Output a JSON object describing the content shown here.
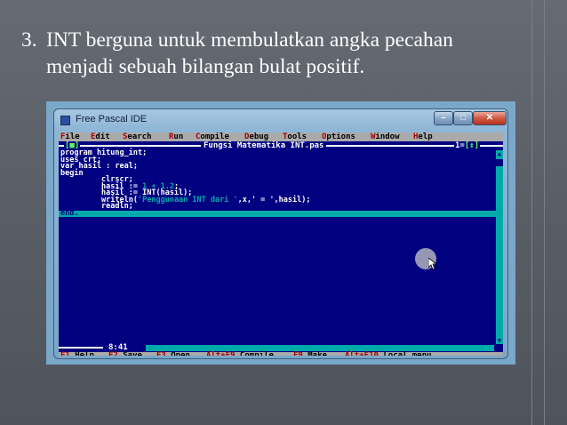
{
  "slide": {
    "number": "3.",
    "line1": "INT berguna untuk membulatkan angka pecahan",
    "line2": "menjadi sebuah bilangan bulat positif."
  },
  "window": {
    "title": "Free Pascal IDE",
    "minimize": "–",
    "maximize": "□",
    "close": "✕"
  },
  "menu": [
    {
      "hotkey": "F",
      "rest": "ile"
    },
    {
      "hotkey": "E",
      "rest": "dit"
    },
    {
      "hotkey": "S",
      "rest": "earch"
    },
    {
      "hotkey": "R",
      "rest": "un"
    },
    {
      "hotkey": "C",
      "rest": "ompile"
    },
    {
      "hotkey": "D",
      "rest": "ebug"
    },
    {
      "hotkey": "T",
      "rest": "ools"
    },
    {
      "hotkey": "O",
      "rest": "ptions"
    },
    {
      "hotkey": "W",
      "rest": "indow"
    },
    {
      "hotkey": "H",
      "rest": "elp"
    }
  ],
  "editor": {
    "close_box": "[■]",
    "file_title": "Fungsi Matematika INT.pas",
    "window_num": "1",
    "zoom_box": "[↕]",
    "position": "8:41",
    "code": [
      {
        "text": "program hitung_int;"
      },
      {
        "text": "uses crt;"
      },
      {
        "text": "var hasil : real;"
      },
      {
        "text": "begin"
      },
      {
        "text": "         clrscr;"
      },
      {
        "text": "         hasil := ",
        "num": "1 + 1.2",
        "after": ";"
      },
      {
        "text": "         hasil := INT(hasil);"
      },
      {
        "text": "         writeln(",
        "str": "'Penggunaan INT dari '",
        "after": ",x,' = ',hasil);"
      },
      {
        "text": "         readln;"
      },
      {
        "text": "end.",
        "current": true
      }
    ]
  },
  "statusbar": [
    {
      "key": "F1",
      "label": " Help"
    },
    {
      "key": "F2",
      "label": " Save"
    },
    {
      "key": "F3",
      "label": " Open"
    },
    {
      "key": "Alt+F9",
      "label": " Compile"
    },
    {
      "key": "F9",
      "label": " Make"
    },
    {
      "key": "Alt+F10",
      "label": " Local menu"
    }
  ]
}
